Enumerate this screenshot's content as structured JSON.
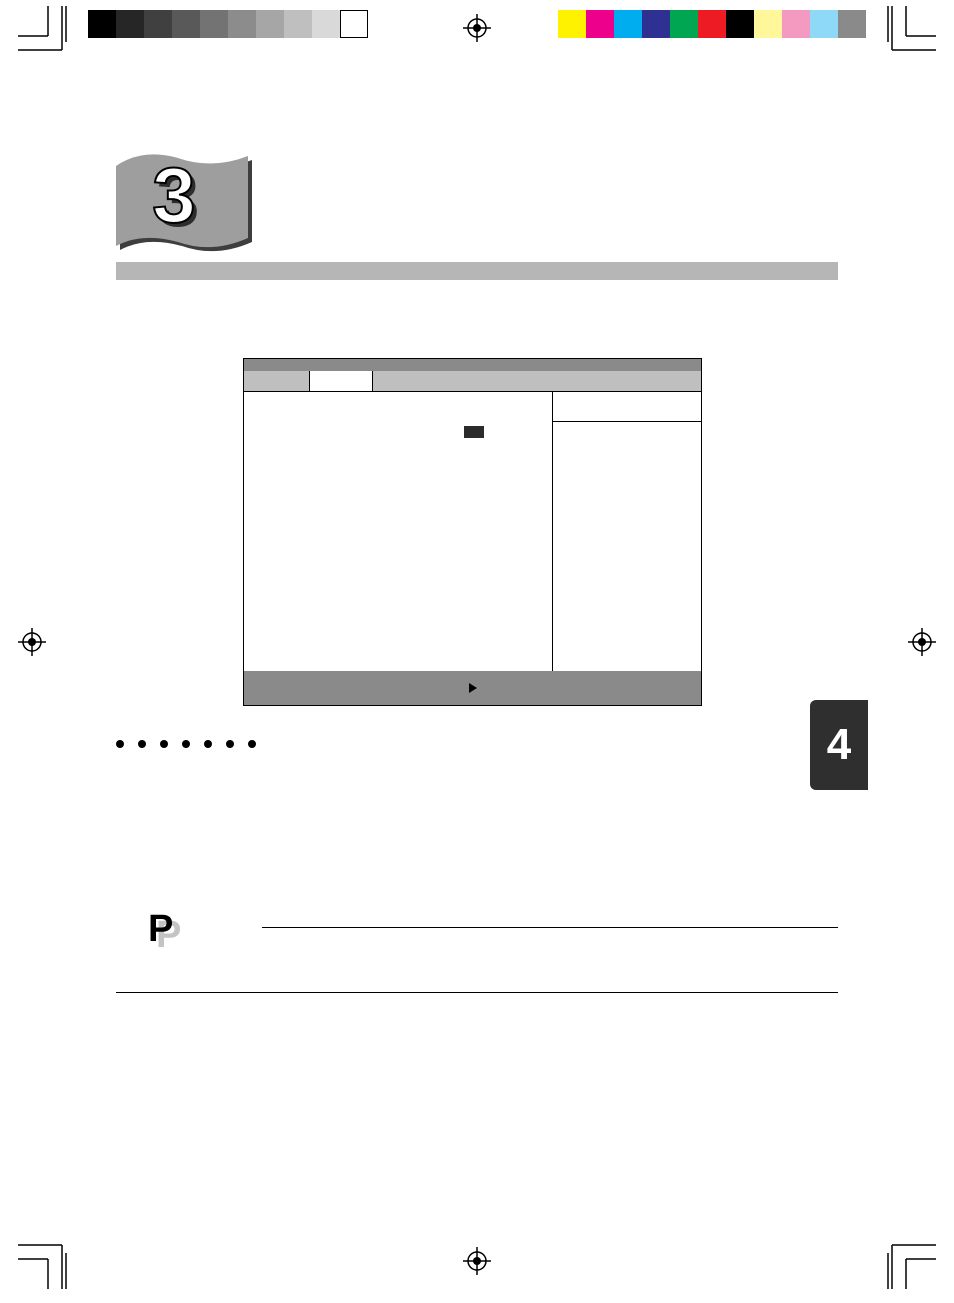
{
  "page": {
    "chapter_number": "3",
    "side_tab_number": "4"
  },
  "print_marks": {
    "gray_swatches": [
      "#000000",
      "#262626",
      "#404040",
      "#595959",
      "#737373",
      "#8c8c8c",
      "#a6a6a6",
      "#bfbfbf",
      "#d9d9d9",
      "#ffffff"
    ],
    "color_swatches": [
      "#fff200",
      "#ec008c",
      "#00aeef",
      "#2e3192",
      "#00a651",
      "#ed1c24",
      "#000000",
      "#fff799",
      "#f49ac1",
      "#8ed8f8",
      "#8a8a8a"
    ]
  },
  "ui_window": {
    "titlebar_label": "",
    "active_tab_label": "",
    "footer_label": ""
  },
  "point": {
    "letter": "P"
  }
}
